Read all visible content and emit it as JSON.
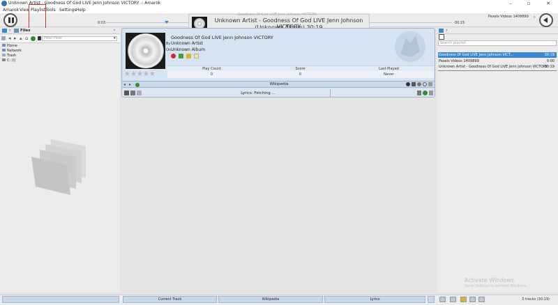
{
  "window": {
    "title": "Unknown Artist - Goodness Of God LIVE  Jenn Johnson  VICTORY :: Amarok",
    "controls": [
      "–",
      "▫",
      "✕"
    ]
  },
  "menu": [
    "Amarok",
    "View",
    "Playlist",
    "Tools",
    "Settings",
    "Help"
  ],
  "toolbar": {
    "elapsed": "0:03",
    "remaining": "-30:15",
    "next_track": "Pexels Videos 1409899"
  },
  "osd": {
    "line1": "Unknown Artist - Goodness Of God LIVE  Jenn Johnson  VICTORY",
    "line2": "(Unknown Album) 30:19",
    "watermark": "Goodness Of God LIVE  Jenn Johnson  VICTORY"
  },
  "browser": {
    "header": "Files",
    "filter_placeholder": "Filter Filter",
    "places": [
      "Home",
      "Network",
      "Trash",
      "C: (\\)"
    ]
  },
  "current_track": {
    "title": "Goodness Of God LIVE Jenn Johnson VICTORY",
    "by_label": "By",
    "artist": "Unknown Artist",
    "on_label": "On",
    "album": "Unknown Album",
    "stats_headers": [
      "Play Count",
      "Score",
      "Last Played"
    ],
    "stats_values": [
      "0",
      "0",
      "Never"
    ],
    "rating_stars": 0
  },
  "applets": {
    "wikipedia": "Wikipedia",
    "lyrics": "Lyrics: Fetching ..."
  },
  "playlist": {
    "search_placeholder": "Search playlist",
    "rows": [
      {
        "title": "Goodness Of God LIVE  Jenn Johnson  VICT...",
        "length": "30:19",
        "selected": true
      },
      {
        "title": "Pexels Videos 1409899",
        "length": "0:00",
        "selected": false
      },
      {
        "title": "Unknown Artist - Goodness Of God LIVE  Jenn Johnson  VICTORY",
        "length": "30:19",
        "selected": false
      }
    ],
    "status": "3 tracks (30:19)"
  },
  "bottom_tabs": [
    "Current Track",
    "Wikipedia",
    "Lyrics"
  ],
  "watermark": {
    "line1": "Activate Windows",
    "line2": "Go to Settings to activate Windows."
  }
}
